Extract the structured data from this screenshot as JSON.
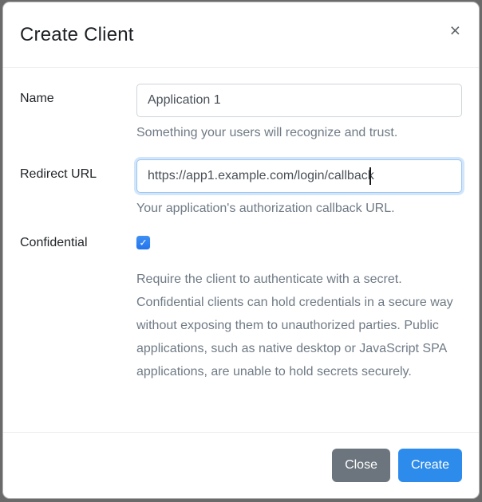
{
  "modal": {
    "title": "Create Client",
    "close_icon": "×",
    "form": {
      "name": {
        "label": "Name",
        "value": "Application 1",
        "help": "Something your users will recognize and trust."
      },
      "redirect": {
        "label": "Redirect URL",
        "value": "https://app1.example.com/login/callback",
        "help": "Your application's authorization callback URL."
      },
      "confidential": {
        "label": "Confidential",
        "checked": "true",
        "check_glyph": "✓",
        "help": "Require the client to authenticate with a secret. Confidential clients can hold credentials in a secure way without exposing them to unauthorized parties. Public applications, such as native desktop or JavaScript SPA applications, are unable to hold secrets securely."
      }
    },
    "footer": {
      "close_label": "Close",
      "create_label": "Create"
    },
    "colors": {
      "primary_button": "#2d8ceb",
      "secondary_button": "#6c757d",
      "checkbox_blue": "#2a7cf0",
      "backdrop": "#6a6a6a"
    }
  }
}
